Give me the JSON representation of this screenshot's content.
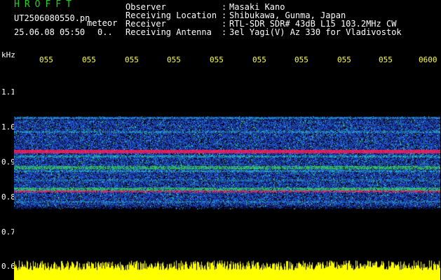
{
  "header": {
    "app_title": "HROFFT",
    "file_name": "UT2506080550.pn",
    "mode_label": "meteor",
    "date_time": "25.06.08 05:50",
    "extra_value": "0.."
  },
  "station_info": [
    {
      "key": "Observer",
      "value": "Masaki Kano"
    },
    {
      "key": "Receiving Location",
      "value": "Shibukawa, Gunma, Japan"
    },
    {
      "key": "Receiver",
      "value": "RTL-SDR SDR# 43dB L15 103.2MHz CW"
    },
    {
      "key": "Receiving Antenna",
      "value": "3el Yagi(V) Az 330 for Vladivostok"
    }
  ],
  "axis": {
    "unit_label": "kHz",
    "time_ticks": [
      "055",
      "055",
      "055",
      "055",
      "055",
      "055",
      "055",
      "055",
      "055",
      "0600"
    ],
    "freq_ticks": [
      "1.1",
      "1.0",
      "0.9",
      "0.8",
      "0.7",
      "0.6"
    ]
  },
  "colors": {
    "background": "#000000",
    "title": "#22d022",
    "tick_label": "#ffff33",
    "signal_bar": "#ffff00",
    "hot_band": "#ff2a6a",
    "band_cyan": "#19c8d2",
    "band_green": "#3ac870",
    "noise_blue": "#1c2ea0"
  }
}
